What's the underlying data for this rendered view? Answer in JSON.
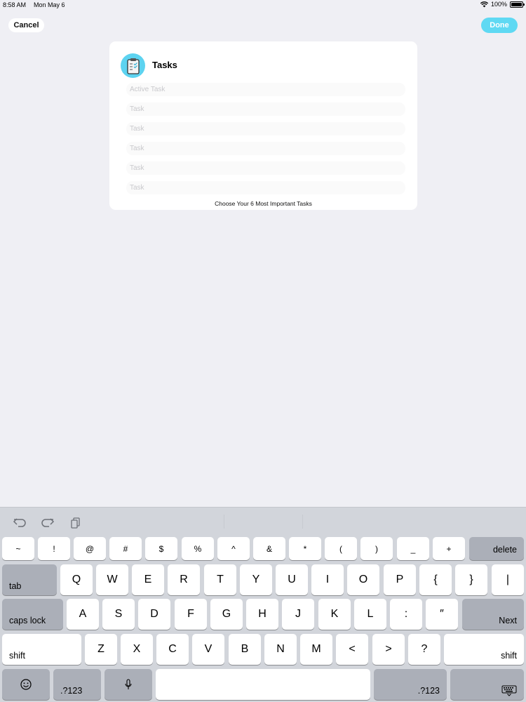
{
  "status": {
    "time": "8:58 AM",
    "date": "Mon May 6",
    "battery": "100%"
  },
  "nav": {
    "cancel_label": "Cancel",
    "done_label": "Done",
    "done_color": "#5fd9f3"
  },
  "card": {
    "title": "Tasks",
    "icon": "clipboard-icon",
    "fields": [
      {
        "placeholder": "Active Task",
        "value": ""
      },
      {
        "placeholder": "Task",
        "value": ""
      },
      {
        "placeholder": "Task",
        "value": ""
      },
      {
        "placeholder": "Task",
        "value": ""
      },
      {
        "placeholder": "Task",
        "value": ""
      },
      {
        "placeholder": "Task",
        "value": ""
      }
    ],
    "hint": "Choose Your 6 Most Important Tasks"
  },
  "keyboard": {
    "toolbar": [
      "undo-icon",
      "redo-icon",
      "paste-icon"
    ],
    "rows": [
      [
        "~",
        "!",
        "@",
        "#",
        "$",
        "%",
        "^",
        "&",
        "*",
        "(",
        ")",
        "_",
        "+",
        "delete"
      ],
      [
        "tab",
        "Q",
        "W",
        "E",
        "R",
        "T",
        "Y",
        "U",
        "I",
        "O",
        "P",
        "{",
        "}",
        "|"
      ],
      [
        "caps lock",
        "A",
        "S",
        "D",
        "F",
        "G",
        "H",
        "J",
        "K",
        "L",
        ":",
        "″",
        "Next"
      ],
      [
        "shift",
        "Z",
        "X",
        "C",
        "V",
        "B",
        "N",
        "M",
        "<",
        ">",
        "?",
        "shift"
      ],
      [
        "emoji-icon",
        ".?123",
        "mic-icon",
        "",
        ".?123",
        "keyboard-dismiss-icon"
      ]
    ]
  }
}
